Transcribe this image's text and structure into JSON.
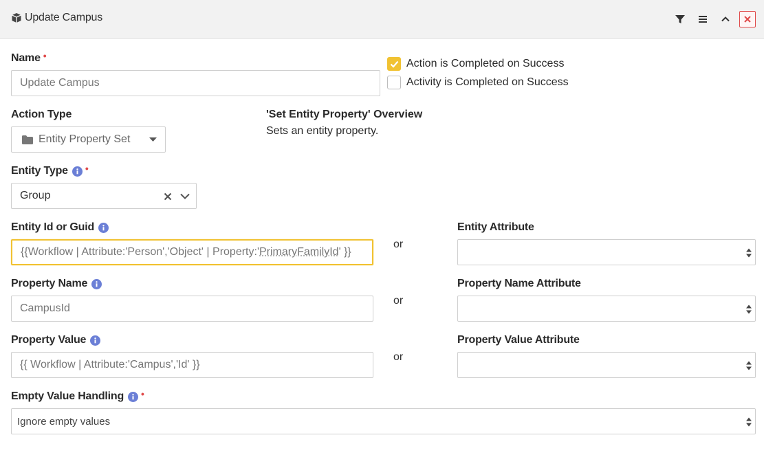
{
  "header": {
    "icon": "cube-icon",
    "title": "Update Campus",
    "actions": [
      "filter-icon",
      "menu-icon",
      "chevron-up-icon",
      "close-icon"
    ]
  },
  "name": {
    "label": "Name",
    "value": "Update Campus"
  },
  "completion": {
    "action_completed_label": "Action is Completed on Success",
    "action_completed_checked": true,
    "activity_completed_label": "Activity is Completed on Success",
    "activity_completed_checked": false
  },
  "action_type": {
    "label": "Action Type",
    "value": "Entity Property Set",
    "icon": "folder-icon"
  },
  "overview": {
    "title": "'Set Entity Property' Overview",
    "text": "Sets an entity property."
  },
  "entity_type": {
    "label": "Entity Type",
    "value": "Group"
  },
  "entity_id": {
    "label": "Entity Id or Guid",
    "value_prefix": "{{Workflow | Attribute:'Person','Object' | Property:'",
    "value_underlined": "PrimaryFamilyId",
    "value_suffix": "' }}"
  },
  "entity_attribute": {
    "label": "Entity Attribute",
    "value": ""
  },
  "property_name": {
    "label": "Property Name",
    "value": "CampusId"
  },
  "property_name_attribute": {
    "label": "Property Name Attribute",
    "value": ""
  },
  "property_value": {
    "label": "Property Value",
    "value": "{{ Workflow | Attribute:'Campus','Id' }}"
  },
  "property_value_attribute": {
    "label": "Property Value Attribute",
    "value": ""
  },
  "empty_value_handling": {
    "label": "Empty Value Handling",
    "value": "Ignore empty values"
  },
  "or_text": "or",
  "colors": {
    "accent": "#f1c232",
    "required": "#e04a4a",
    "info": "#6b7fd6"
  }
}
